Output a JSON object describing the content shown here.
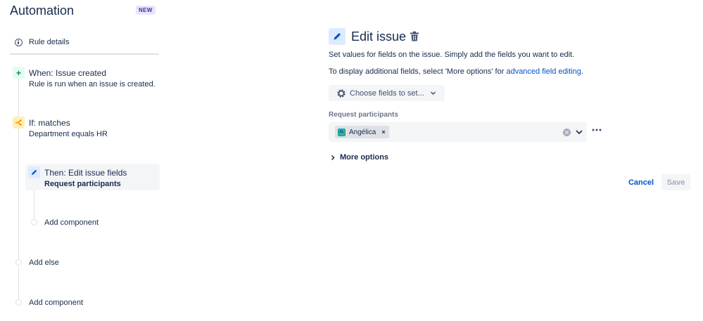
{
  "app": {
    "title": "Automation",
    "badge": "NEW"
  },
  "sidebar": {
    "rule_details": {
      "icon": "info-icon",
      "label": "Rule details"
    },
    "trigger": {
      "icon": "plus-icon",
      "title": "When: Issue created",
      "subtitle": "Rule is run when an issue is created."
    },
    "condition": {
      "icon": "branch-icon",
      "title": "If: matches",
      "subtitle": "Department equals HR"
    },
    "action": {
      "icon": "pencil-icon",
      "title": "Then: Edit issue fields",
      "subtitle": "Request participants"
    },
    "add_component_inner": "Add component",
    "add_else": "Add else",
    "add_component_outer": "Add component"
  },
  "panel": {
    "title": "Edit issue",
    "description_line1": "Set values for fields on the issue. Simply add the fields you want to edit.",
    "description_line2_prefix": "To display additional fields, select 'More options' for ",
    "description_line2_link": "advanced field editing",
    "description_line2_suffix": ".",
    "choose_fields_label": "Choose fields to set...",
    "field": {
      "label": "Request participants",
      "value_initials": "AL",
      "value_name": "Angélica",
      "remove_glyph": "×"
    },
    "more_options_label": "More options",
    "cancel_label": "Cancel",
    "save_label": "Save"
  },
  "colors": {
    "text": "#172b4d",
    "link": "#0052cc",
    "trigger_bg": "#e3fcef",
    "condition_bg": "#fff0b3",
    "action_bg": "#deebff",
    "badge_bg": "#eae6ff"
  }
}
